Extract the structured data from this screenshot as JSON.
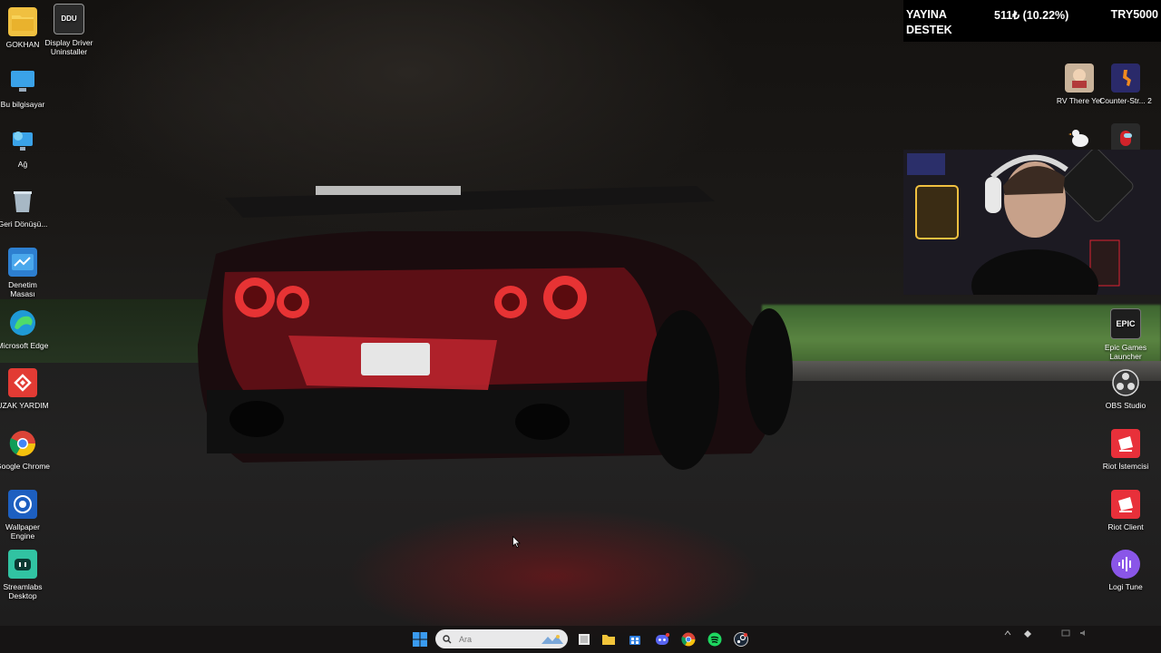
{
  "desktop_left": [
    {
      "name": "desktop-icon-gokhan",
      "label": "GOKHAN",
      "icon": "folder-icon",
      "color": "#f0c040"
    },
    {
      "name": "desktop-icon-display-driver-uninstaller",
      "label": "Display Driver Uninstaller",
      "icon": "ddu-icon",
      "color": "#2b2b2b"
    },
    {
      "name": "desktop-icon-bu-bilgisayar",
      "label": "Bu bilgisayar",
      "icon": "monitor-icon",
      "color": "#2c8fd6"
    },
    {
      "name": "desktop-icon-ag",
      "label": "Ağ",
      "icon": "network-icon",
      "color": "#2c8fd6"
    },
    {
      "name": "desktop-icon-geri-donusum",
      "label": "Geri Dönüşü...",
      "icon": "recycle-bin-icon",
      "color": "#8aa6bd"
    },
    {
      "name": "desktop-icon-denetim-masasi",
      "label": "Denetim Masası",
      "icon": "control-panel-icon",
      "color": "#2d7fd0"
    },
    {
      "name": "desktop-icon-microsoft-edge",
      "label": "Microsoft Edge",
      "icon": "edge-icon",
      "color": "#1f9ad6"
    },
    {
      "name": "desktop-icon-uzak-yardim",
      "label": "UZAK YARDIM",
      "icon": "anydesk-icon",
      "color": "#e23b34"
    },
    {
      "name": "desktop-icon-google-chrome",
      "label": "Google Chrome",
      "icon": "chrome-icon",
      "color": "#4285f4"
    },
    {
      "name": "desktop-icon-wallpaper-engine",
      "label": "Wallpaper Engine",
      "icon": "wallpaper-engine-icon",
      "color": "#1d5fc0"
    },
    {
      "name": "desktop-icon-streamlabs-desktop",
      "label": "Streamlabs Desktop",
      "icon": "streamlabs-icon",
      "color": "#31c3a2"
    }
  ],
  "desktop_right": [
    {
      "name": "desktop-icon-rv-there-yet",
      "label": "RV There Yet",
      "icon": "game-rv-icon",
      "color": "#c9b39a"
    },
    {
      "name": "desktop-icon-counter-strike-2",
      "label": "Counter-Str... 2",
      "icon": "counter-strike-icon",
      "color": "#e58a1f"
    },
    {
      "name": "desktop-icon-epic-games-launcher",
      "label": "Epic Games Launcher",
      "icon": "epic-games-icon",
      "color": "#222222"
    },
    {
      "name": "desktop-icon-obs-studio",
      "label": "OBS Studio",
      "icon": "obs-icon",
      "color": "#3a3a3a"
    },
    {
      "name": "desktop-icon-riot-istemcisi",
      "label": "Riot İstemcisi",
      "icon": "riot-icon",
      "color": "#e8303a"
    },
    {
      "name": "desktop-icon-riot-client",
      "label": "Riot Client",
      "icon": "riot-icon",
      "color": "#e8303a"
    },
    {
      "name": "desktop-icon-logi-tune",
      "label": "Logi Tune",
      "icon": "logi-tune-icon",
      "color": "#8a56e8"
    }
  ],
  "overlay": {
    "donation_line1": "YAYINA",
    "donation_line2": "DESTEK",
    "donation_amount": "511₺ (10.22%)",
    "donation_goal": "TRY5000",
    "donation_progress_fraction": 0.1022
  },
  "taskbar": {
    "search_placeholder": "Ara",
    "items": [
      "start-icon",
      "file-explorer-icon",
      "folder-icon",
      "store-icon",
      "discord-icon",
      "chrome-icon",
      "spotify-icon",
      "steam-icon"
    ]
  }
}
